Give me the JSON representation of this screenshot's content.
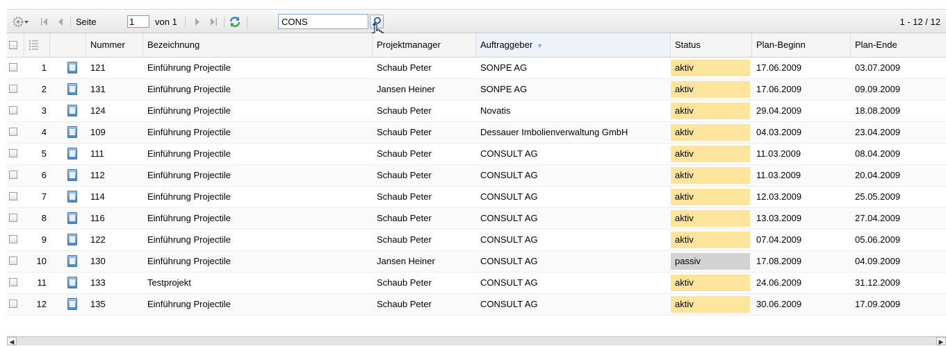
{
  "toolbar": {
    "page_label": "Seite",
    "page_value": "1",
    "of_label": "von 1",
    "search_value": "CONS",
    "range_text": "1 - 12 / 12"
  },
  "columns": {
    "nummer": "Nummer",
    "bezeichnung": "Bezeichnung",
    "projektmanager": "Projektmanager",
    "auftraggeber": "Auftraggeber",
    "status": "Status",
    "plan_beginn": "Plan-Beginn",
    "plan_ende": "Plan-Ende"
  },
  "rows": [
    {
      "idx": "1",
      "nummer": "121",
      "bezeichnung": "Einführung Projectile",
      "pm": "Schaub Peter",
      "ag": "SONPE AG",
      "status": "aktiv",
      "beginn": "17.06.2009",
      "ende": "03.07.2009"
    },
    {
      "idx": "2",
      "nummer": "131",
      "bezeichnung": "Einführung Projectile",
      "pm": "Jansen Heiner",
      "ag": "SONPE AG",
      "status": "aktiv",
      "beginn": "17.06.2009",
      "ende": "09.09.2009"
    },
    {
      "idx": "3",
      "nummer": "124",
      "bezeichnung": "Einführung Projectile",
      "pm": "Schaub Peter",
      "ag": "Novatis",
      "status": "aktiv",
      "beginn": "29.04.2009",
      "ende": "18.08.2009"
    },
    {
      "idx": "4",
      "nummer": "109",
      "bezeichnung": "Einführung Projectile",
      "pm": "Schaub Peter",
      "ag": "Dessauer Imbolienverwaltung GmbH",
      "status": "aktiv",
      "beginn": "04.03.2009",
      "ende": "23.04.2009"
    },
    {
      "idx": "5",
      "nummer": "111",
      "bezeichnung": "Einführung Projectile",
      "pm": "Schaub Peter",
      "ag": "CONSULT AG",
      "status": "aktiv",
      "beginn": "11.03.2009",
      "ende": "08.04.2009"
    },
    {
      "idx": "6",
      "nummer": "112",
      "bezeichnung": "Einführung Projectile",
      "pm": "Schaub Peter",
      "ag": "CONSULT AG",
      "status": "aktiv",
      "beginn": "11.03.2009",
      "ende": "20.04.2009"
    },
    {
      "idx": "7",
      "nummer": "114",
      "bezeichnung": "Einführung Projectile",
      "pm": "Schaub Peter",
      "ag": "CONSULT AG",
      "status": "aktiv",
      "beginn": "12.03.2009",
      "ende": "25.05.2009"
    },
    {
      "idx": "8",
      "nummer": "116",
      "bezeichnung": "Einführung Projectile",
      "pm": "Schaub Peter",
      "ag": "CONSULT AG",
      "status": "aktiv",
      "beginn": "13.03.2009",
      "ende": "27.04.2009"
    },
    {
      "idx": "9",
      "nummer": "122",
      "bezeichnung": "Einführung Projectile",
      "pm": "Schaub Peter",
      "ag": "CONSULT AG",
      "status": "aktiv",
      "beginn": "07.04.2009",
      "ende": "05.06.2009"
    },
    {
      "idx": "10",
      "nummer": "130",
      "bezeichnung": "Einführung Projectile",
      "pm": "Jansen Heiner",
      "ag": "CONSULT AG",
      "status": "passiv",
      "beginn": "17.08.2009",
      "ende": "04.09.2009"
    },
    {
      "idx": "11",
      "nummer": "133",
      "bezeichnung": "Testprojekt",
      "pm": "Schaub Peter",
      "ag": "CONSULT AG",
      "status": "aktiv",
      "beginn": "24.06.2009",
      "ende": "31.12.2009"
    },
    {
      "idx": "12",
      "nummer": "135",
      "bezeichnung": "Einführung Projectile",
      "pm": "Schaub Peter",
      "ag": "CONSULT AG",
      "status": "aktiv",
      "beginn": "30.06.2009",
      "ende": "17.09.2009"
    }
  ],
  "colors": {
    "aktiv": "#fde59d",
    "passiv": "#d3d3d3",
    "accent": "#7fa2cf"
  },
  "icons": [
    "gear-icon",
    "first-page-icon",
    "prev-page-icon",
    "next-page-icon",
    "last-page-icon",
    "refresh-icon",
    "search-icon",
    "column-chooser-icon",
    "document-icon"
  ]
}
